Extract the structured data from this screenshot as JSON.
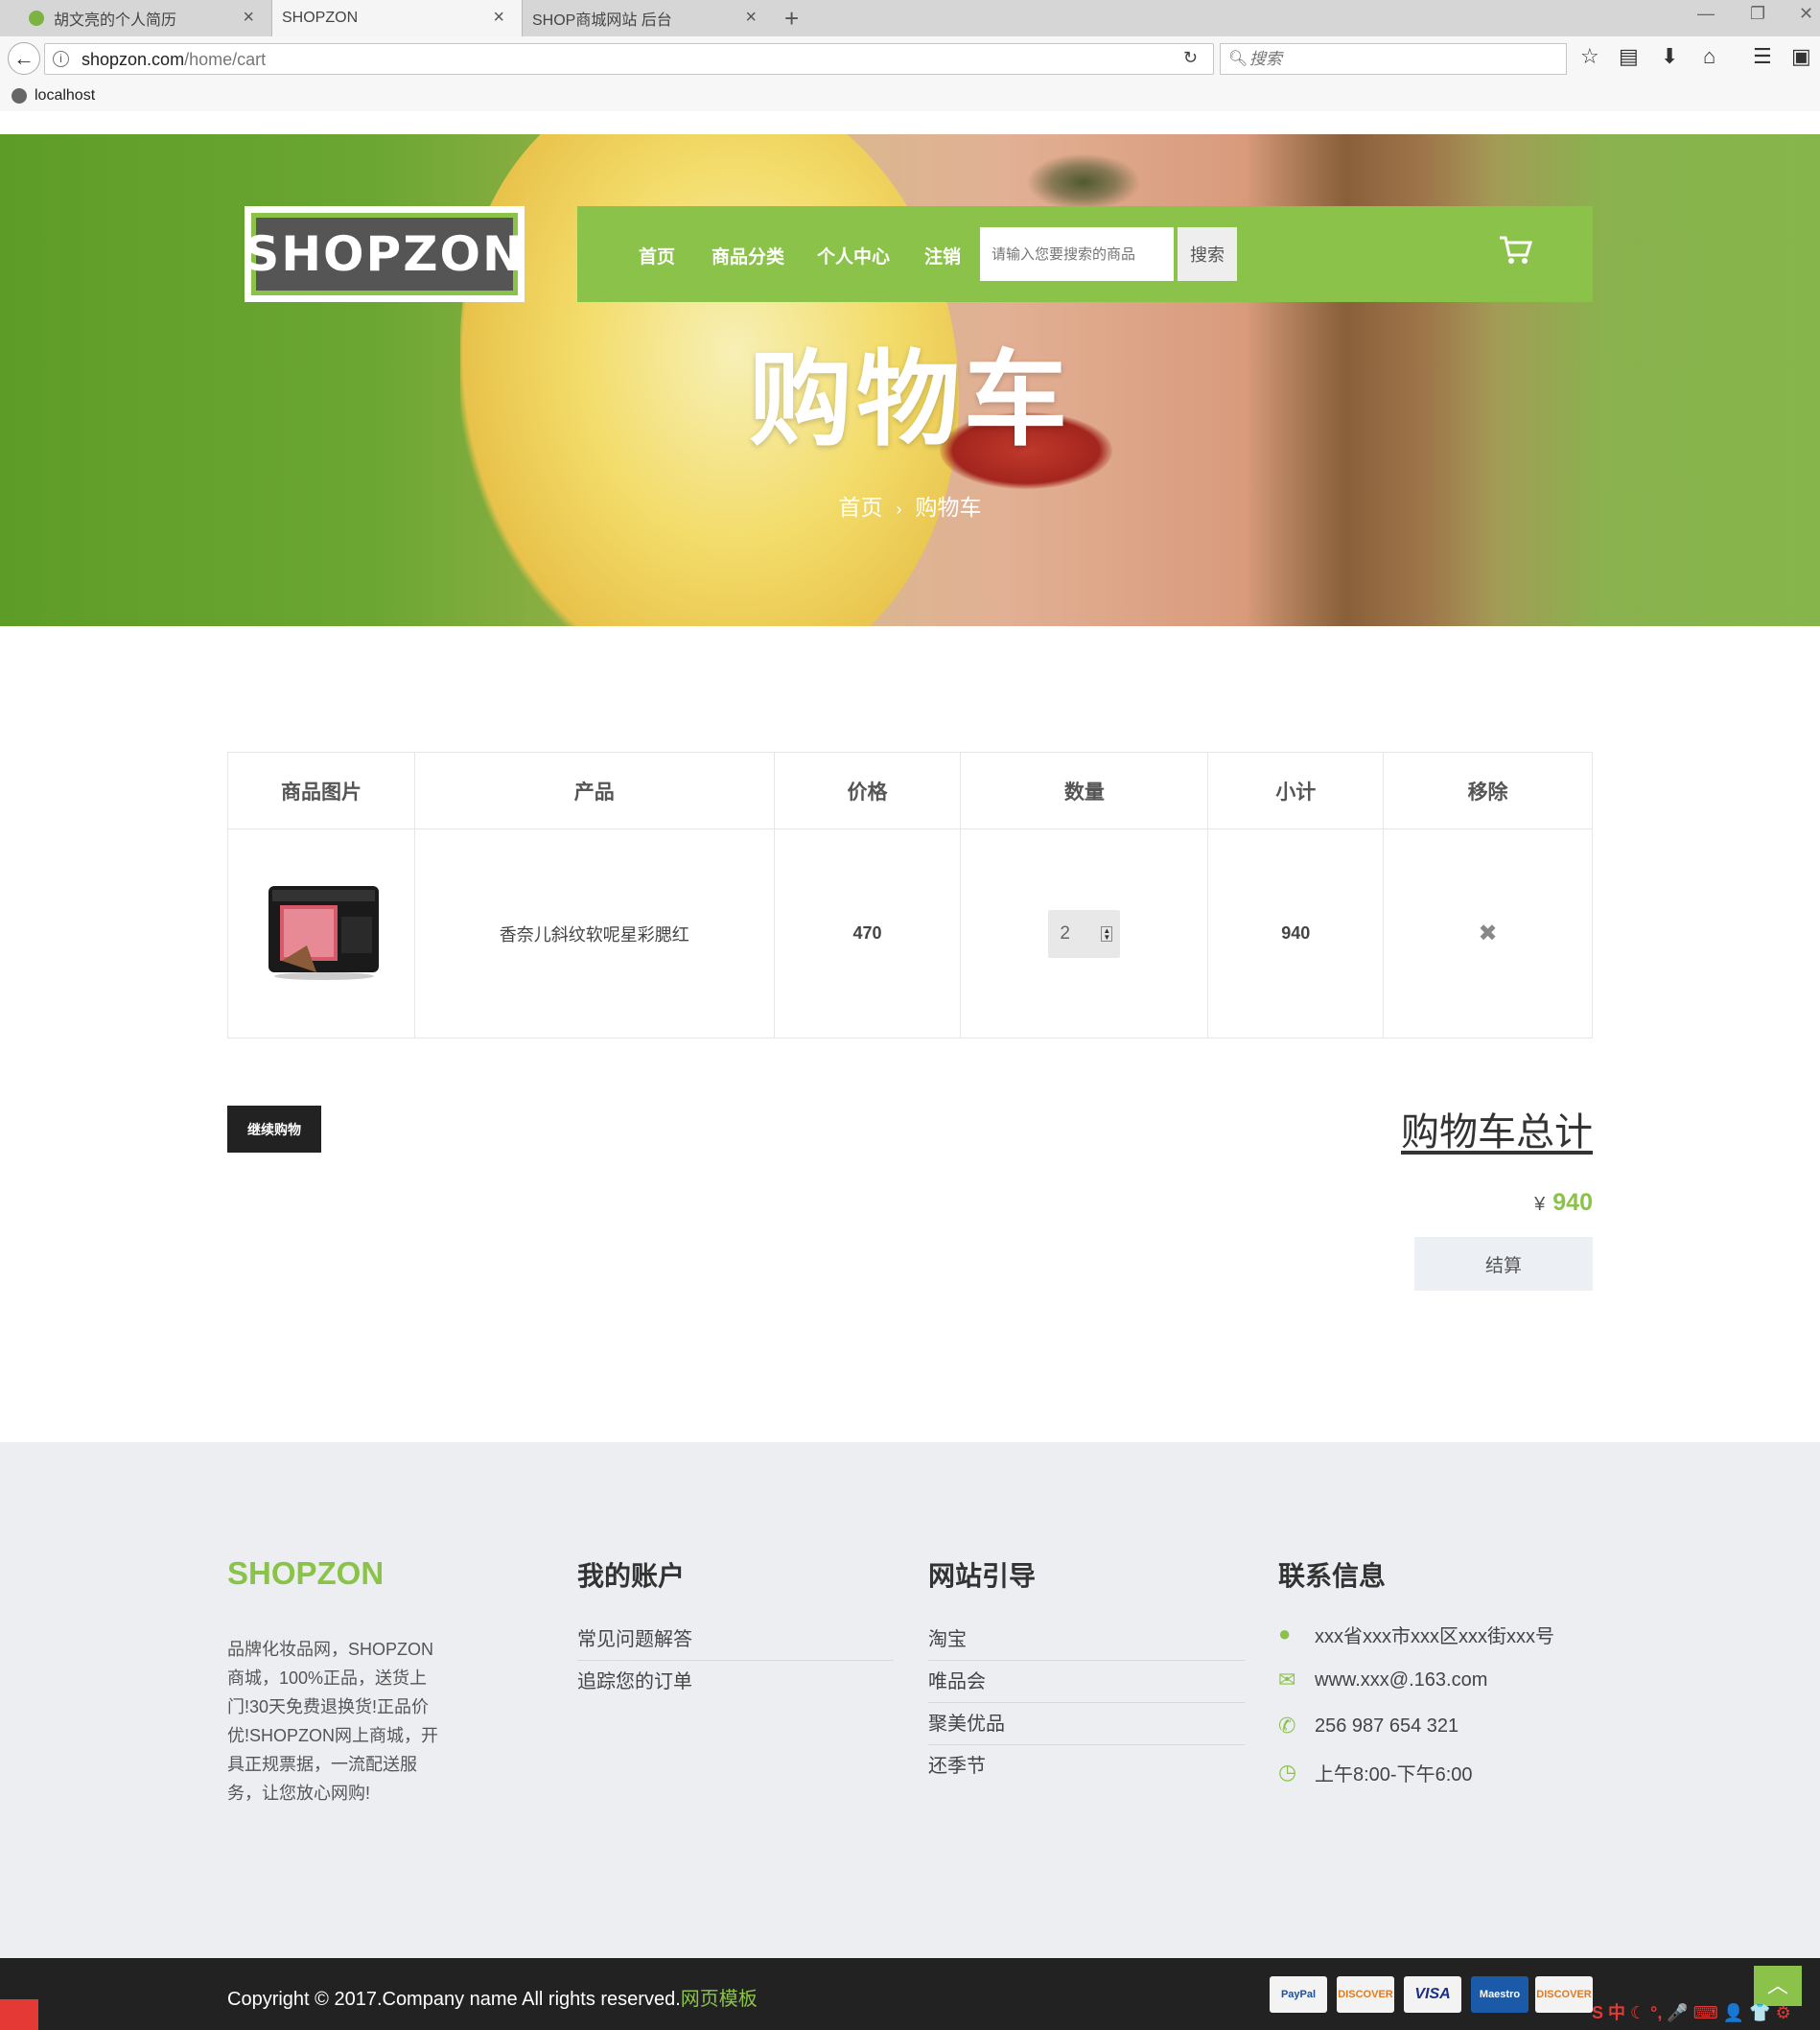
{
  "browser": {
    "tabs": [
      {
        "label": "胡文亮的个人简历"
      },
      {
        "label": "SHOPZON"
      },
      {
        "label": "SHOP商城网站 后台"
      }
    ],
    "url_domain": "shopzon.com",
    "url_path": "/home/cart",
    "search_placeholder": "搜索",
    "bookmark": "localhost"
  },
  "site": {
    "logo": "SHOPZON",
    "nav": [
      "首页",
      "商品分类",
      "个人中心",
      "注销"
    ],
    "search_placeholder": "请输入您要搜索的商品",
    "search_button": "搜索"
  },
  "hero": {
    "title": "购物车",
    "breadcrumb": [
      "首页",
      "购物车"
    ]
  },
  "cart": {
    "headers": [
      "商品图片",
      "产品",
      "价格",
      "数量",
      "小计",
      "移除"
    ],
    "items": [
      {
        "name": "香奈儿斜纹软呢星彩腮红",
        "price": "470",
        "quantity": "2",
        "subtotal": "940"
      }
    ],
    "continue_label": "继续购物",
    "total_title": "购物车总计",
    "currency": "¥",
    "total": "940",
    "checkout_label": "结算"
  },
  "footer": {
    "brand": "SHOPZON",
    "description": "品牌化妆品网，SHOPZON商城，100%正品，送货上门!30天免费退换货!正品价优!SHOPZON网上商城，开具正规票据，一流配送服务，让您放心网购!",
    "account_title": "我的账户",
    "account_links": [
      "常见问题解答",
      "追踪您的订单"
    ],
    "guide_title": "网站引导",
    "guide_links": [
      "淘宝",
      "唯品会",
      "聚美优品",
      "还季节"
    ],
    "contact_title": "联系信息",
    "contact": {
      "address": "xxx省xxx市xxx区xxx街xxx号",
      "email": "www.xxx@.163.com",
      "phone": "256 987 654 321",
      "hours": "上午8:00-下午6:00"
    },
    "copyright": "Copyright © 2017.Company name All rights reserved.",
    "copyright_link": "网页模板",
    "payments": [
      "PayPal",
      "DISCOVER",
      "VISA",
      "Maestro",
      "DISCOVER"
    ]
  },
  "colors": {
    "accent": "#8bc34a",
    "dark": "#222222",
    "footer_bg": "#eceef2"
  }
}
